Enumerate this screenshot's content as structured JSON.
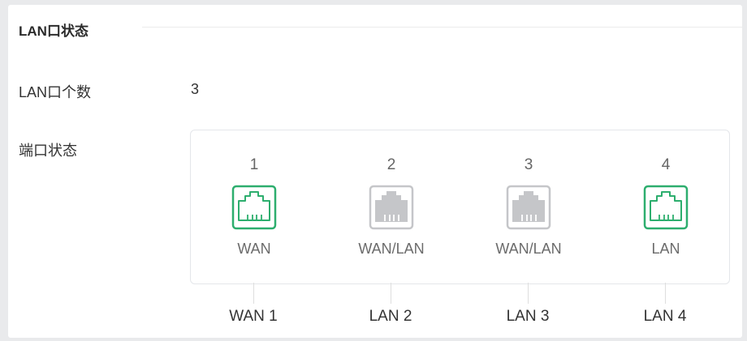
{
  "section": {
    "title": "LAN口状态"
  },
  "lan_count": {
    "label": "LAN口个数",
    "value": "3"
  },
  "port_status": {
    "label": "端口状态"
  },
  "colors": {
    "active": "#2dae6e",
    "inactive": "#c5c6c9"
  },
  "ports": [
    {
      "number": "1",
      "type": "WAN",
      "label": "WAN 1",
      "state": "active",
      "icon": "ethernet-port-icon"
    },
    {
      "number": "2",
      "type": "WAN/LAN",
      "label": "LAN 2",
      "state": "inactive",
      "icon": "ethernet-port-icon"
    },
    {
      "number": "3",
      "type": "WAN/LAN",
      "label": "LAN 3",
      "state": "inactive",
      "icon": "ethernet-port-icon"
    },
    {
      "number": "4",
      "type": "LAN",
      "label": "LAN 4",
      "state": "active",
      "icon": "ethernet-port-icon"
    }
  ]
}
